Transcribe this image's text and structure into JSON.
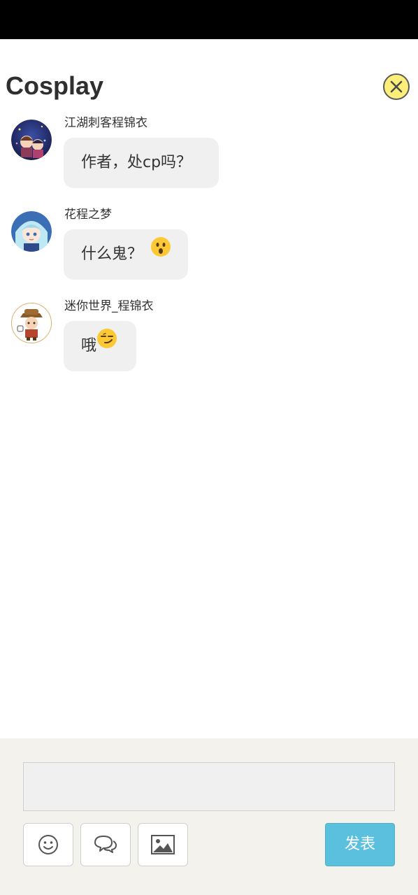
{
  "header": {
    "title": "Cosplay",
    "close_icon": "close-circle-icon"
  },
  "messages": [
    {
      "author": "江湖刺客程锦衣",
      "text": "作者，处cp吗？",
      "emoji": ""
    },
    {
      "author": "花程之梦",
      "text": "什么鬼？",
      "emoji": "astonished-face"
    },
    {
      "author": "迷你世界_程锦衣",
      "text": "哦",
      "emoji": "smirking-face"
    }
  ],
  "composer": {
    "input_value": "",
    "input_placeholder": "",
    "tools": [
      "smiley-icon",
      "chat-bubbles-icon",
      "image-icon"
    ],
    "publish_label": "发表"
  },
  "colors": {
    "status_bar": "#000000",
    "close_button": "#fbef7a",
    "bubble": "#f0f0f0",
    "composer_bg": "#f3f2ec",
    "publish_button": "#5bc0de"
  }
}
